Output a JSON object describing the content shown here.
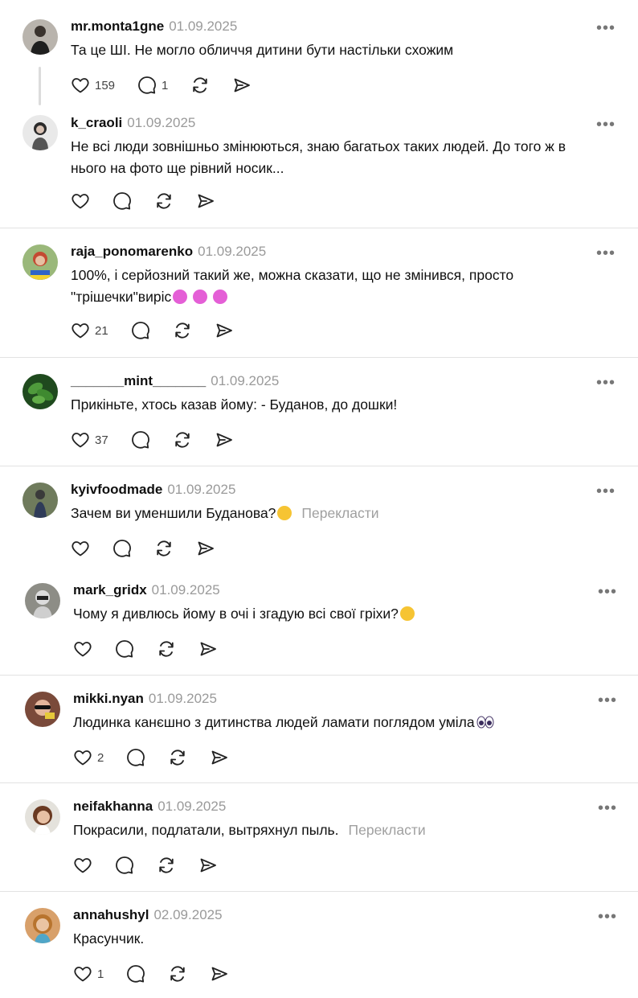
{
  "posts": [
    {
      "username": "mr.monta1gne",
      "date": "01.09.2025",
      "text": "Та це ШІ. Не могло обличчя дитини бути настільки схожим",
      "likes": "159",
      "replies": "1"
    },
    {
      "username": "k_craoli",
      "date": "01.09.2025",
      "text_line1": "Не всі люди зовнішньо змінюються, знаю багатьох таких людей. До того ж в",
      "text_line2": "нього на фото ще рівний носик..."
    },
    {
      "username": "raja_ponomarenko",
      "date": "01.09.2025",
      "text_line1": "100%, і серйозний такий же, можна сказати, що не змінився, просто",
      "text_line2": "\"трішечки\"виріс",
      "likes": "21"
    },
    {
      "username": "_______mint_______",
      "date": "01.09.2025",
      "text": "Прикіньте, хтось казав йому: - Буданов, до дошки!",
      "likes": "37"
    },
    {
      "username": "kyivfoodmade",
      "date": "01.09.2025",
      "text": "Зачем ви уменшили Буданова?",
      "translate": "Перекласти"
    },
    {
      "username": "mark_gridx",
      "date": "01.09.2025",
      "text": "Чому я дивлюсь йому в очі і згадую всі свої гріхи?"
    },
    {
      "username": "mikki.nyan",
      "date": "01.09.2025",
      "text": "Людинка канєшно з дитинства людей ламати поглядом уміла",
      "likes": "2"
    },
    {
      "username": "neifakhanna",
      "date": "01.09.2025",
      "text": "Покрасили, подлатали, вытряхнул пыль.",
      "translate": "Перекласти"
    },
    {
      "username": "annahushyl",
      "date": "02.09.2025",
      "text": "Красунчик.",
      "likes": "1"
    }
  ],
  "more_label": "•••",
  "icons": [
    "heart-icon",
    "comment-icon",
    "repost-icon",
    "share-icon",
    "more-icon"
  ]
}
